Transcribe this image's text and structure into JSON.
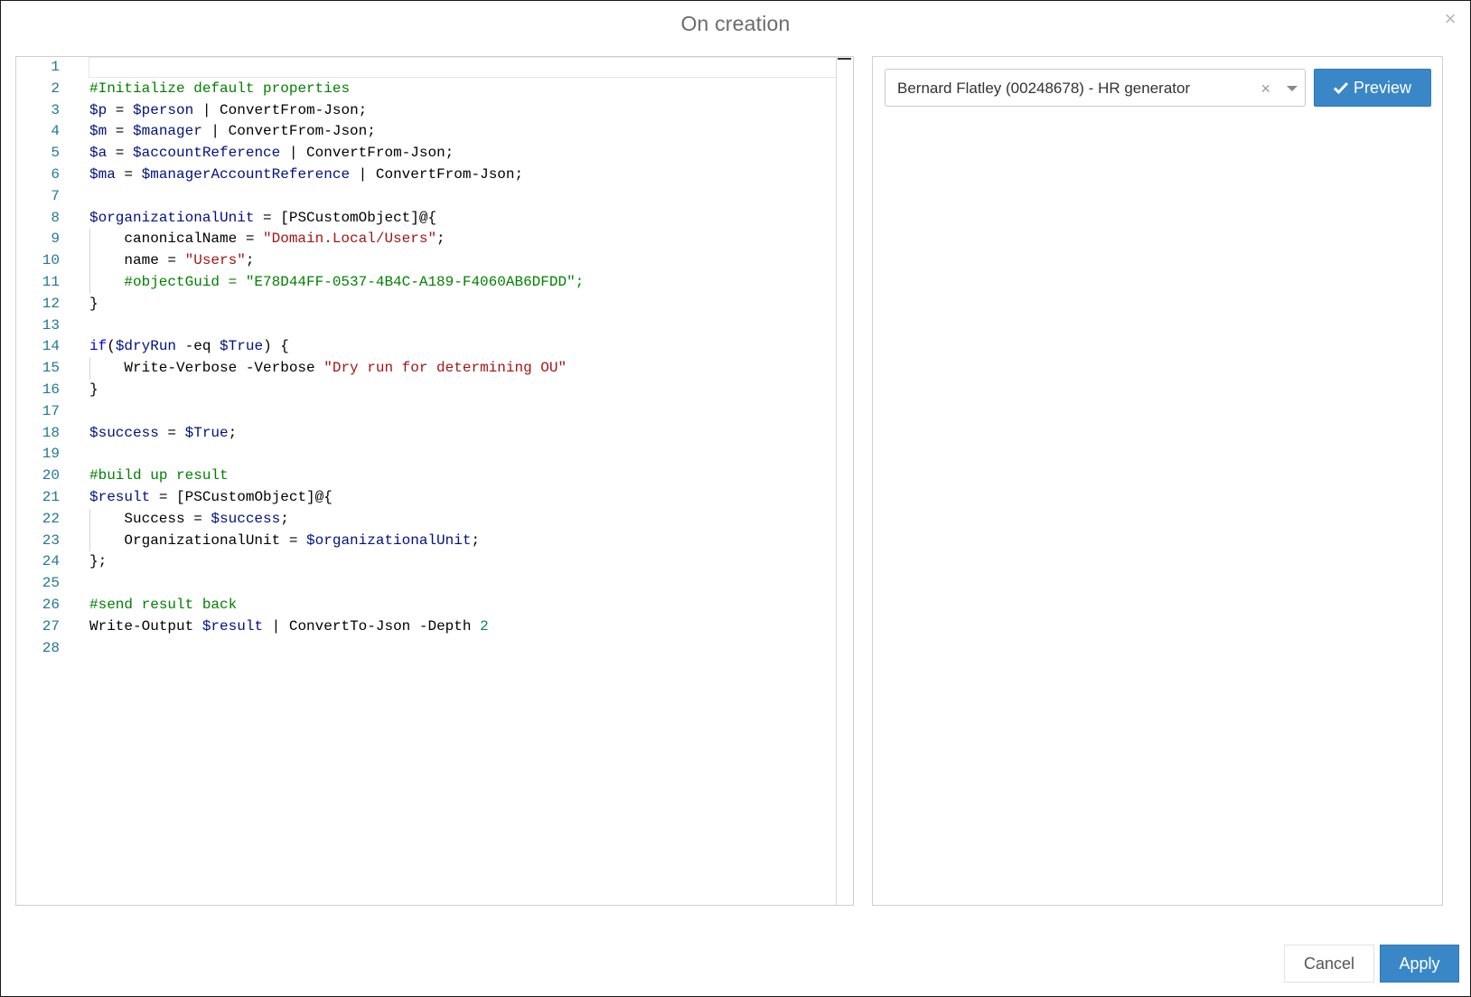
{
  "dialog": {
    "title": "On creation",
    "close_icon": "close-icon"
  },
  "editor": {
    "lines": [
      {
        "n": "1",
        "indent": 0,
        "tokens": []
      },
      {
        "n": "2",
        "indent": 0,
        "tokens": [
          [
            "com",
            "#Initialize default properties"
          ]
        ]
      },
      {
        "n": "3",
        "indent": 0,
        "tokens": [
          [
            "var",
            "$p"
          ],
          [
            "plain",
            " = "
          ],
          [
            "var",
            "$person"
          ],
          [
            "plain",
            " | ConvertFrom-Json;"
          ]
        ]
      },
      {
        "n": "4",
        "indent": 0,
        "tokens": [
          [
            "var",
            "$m"
          ],
          [
            "plain",
            " = "
          ],
          [
            "var",
            "$manager"
          ],
          [
            "plain",
            " | ConvertFrom-Json;"
          ]
        ]
      },
      {
        "n": "5",
        "indent": 0,
        "tokens": [
          [
            "var",
            "$a"
          ],
          [
            "plain",
            " = "
          ],
          [
            "var",
            "$accountReference"
          ],
          [
            "plain",
            " | ConvertFrom-Json;"
          ]
        ]
      },
      {
        "n": "6",
        "indent": 0,
        "tokens": [
          [
            "var",
            "$ma"
          ],
          [
            "plain",
            " = "
          ],
          [
            "var",
            "$managerAccountReference"
          ],
          [
            "plain",
            " | ConvertFrom-Json;"
          ]
        ]
      },
      {
        "n": "7",
        "indent": 0,
        "tokens": []
      },
      {
        "n": "8",
        "indent": 0,
        "tokens": [
          [
            "var",
            "$organizationalUnit"
          ],
          [
            "plain",
            " = [PSCustomObject]@{"
          ]
        ]
      },
      {
        "n": "9",
        "indent": 1,
        "tokens": [
          [
            "plain",
            "canonicalName = "
          ],
          [
            "str",
            "\"Domain.Local/Users\""
          ],
          [
            "plain",
            ";"
          ]
        ]
      },
      {
        "n": "10",
        "indent": 1,
        "tokens": [
          [
            "plain",
            "name = "
          ],
          [
            "str",
            "\"Users\""
          ],
          [
            "plain",
            ";"
          ]
        ]
      },
      {
        "n": "11",
        "indent": 1,
        "tokens": [
          [
            "com",
            "#objectGuid = \"E78D44FF-0537-4B4C-A189-F4060AB6DFDD\";"
          ]
        ]
      },
      {
        "n": "12",
        "indent": 0,
        "tokens": [
          [
            "plain",
            "}"
          ]
        ]
      },
      {
        "n": "13",
        "indent": 0,
        "tokens": []
      },
      {
        "n": "14",
        "indent": 0,
        "tokens": [
          [
            "kw",
            "if"
          ],
          [
            "plain",
            "("
          ],
          [
            "var",
            "$dryRun"
          ],
          [
            "plain",
            " -eq "
          ],
          [
            "var",
            "$True"
          ],
          [
            "plain",
            ") {"
          ]
        ]
      },
      {
        "n": "15",
        "indent": 1,
        "tokens": [
          [
            "plain",
            "Write-Verbose -Verbose "
          ],
          [
            "str",
            "\"Dry run for determining OU\""
          ]
        ]
      },
      {
        "n": "16",
        "indent": 0,
        "tokens": [
          [
            "plain",
            "}"
          ]
        ]
      },
      {
        "n": "17",
        "indent": 0,
        "tokens": []
      },
      {
        "n": "18",
        "indent": 0,
        "tokens": [
          [
            "var",
            "$success"
          ],
          [
            "plain",
            " = "
          ],
          [
            "var",
            "$True"
          ],
          [
            "plain",
            ";"
          ]
        ]
      },
      {
        "n": "19",
        "indent": 0,
        "tokens": []
      },
      {
        "n": "20",
        "indent": 0,
        "tokens": [
          [
            "com",
            "#build up result"
          ]
        ]
      },
      {
        "n": "21",
        "indent": 0,
        "tokens": [
          [
            "var",
            "$result"
          ],
          [
            "plain",
            " = [PSCustomObject]@{"
          ]
        ]
      },
      {
        "n": "22",
        "indent": 1,
        "tokens": [
          [
            "plain",
            "Success = "
          ],
          [
            "var",
            "$success"
          ],
          [
            "plain",
            ";"
          ]
        ]
      },
      {
        "n": "23",
        "indent": 1,
        "tokens": [
          [
            "plain",
            "OrganizationalUnit = "
          ],
          [
            "var",
            "$organizationalUnit"
          ],
          [
            "plain",
            ";"
          ]
        ]
      },
      {
        "n": "24",
        "indent": 0,
        "tokens": [
          [
            "plain",
            "};"
          ]
        ]
      },
      {
        "n": "25",
        "indent": 0,
        "tokens": []
      },
      {
        "n": "26",
        "indent": 0,
        "tokens": [
          [
            "com",
            "#send result back"
          ]
        ]
      },
      {
        "n": "27",
        "indent": 0,
        "tokens": [
          [
            "plain",
            "Write-Output "
          ],
          [
            "var",
            "$result"
          ],
          [
            "plain",
            " | ConvertTo-Json -Depth "
          ],
          [
            "num",
            "2"
          ]
        ]
      },
      {
        "n": "28",
        "indent": 0,
        "tokens": []
      }
    ]
  },
  "preview": {
    "selected_person": "Bernard Flatley (00248678) - HR generator",
    "clear_symbol": "×",
    "button_label": "Preview",
    "button_icon": "check-icon"
  },
  "footer": {
    "cancel_label": "Cancel",
    "apply_label": "Apply"
  },
  "colors": {
    "accent": "#3a87c8",
    "line_number": "#237893",
    "variable": "#001080",
    "keyword": "#0000ff",
    "comment": "#008000",
    "string": "#a31515",
    "number": "#098658"
  }
}
